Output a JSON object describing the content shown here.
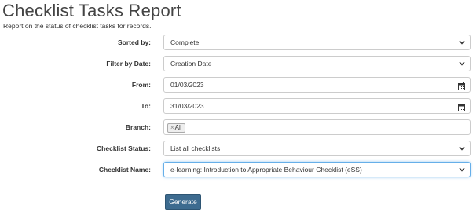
{
  "page": {
    "title": "Checklist Tasks Report",
    "subtitle": "Report on the status of checklist tasks for records."
  },
  "form": {
    "sorted_by": {
      "label": "Sorted by:",
      "value": "Complete"
    },
    "filter_by_date": {
      "label": "Filter by Date:",
      "value": "Creation Date"
    },
    "from": {
      "label": "From:",
      "value": "01/03/2023"
    },
    "to": {
      "label": "To:",
      "value": "31/03/2023"
    },
    "branch": {
      "label": "Branch:",
      "tag_remove": "×",
      "tag_value": "All"
    },
    "checklist_status": {
      "label": "Checklist Status:",
      "value": "List all checklists"
    },
    "checklist_name": {
      "label": "Checklist Name:",
      "value": "e-learning: Introduction to Appropriate Behaviour Checklist (eSS)"
    }
  },
  "actions": {
    "generate_label": "Generate"
  },
  "colors": {
    "button_bg": "#3d6b8f",
    "focus_border": "#66afe9"
  },
  "icons": {
    "dropdown": "chevron-down-icon",
    "date": "calendar-icon"
  }
}
